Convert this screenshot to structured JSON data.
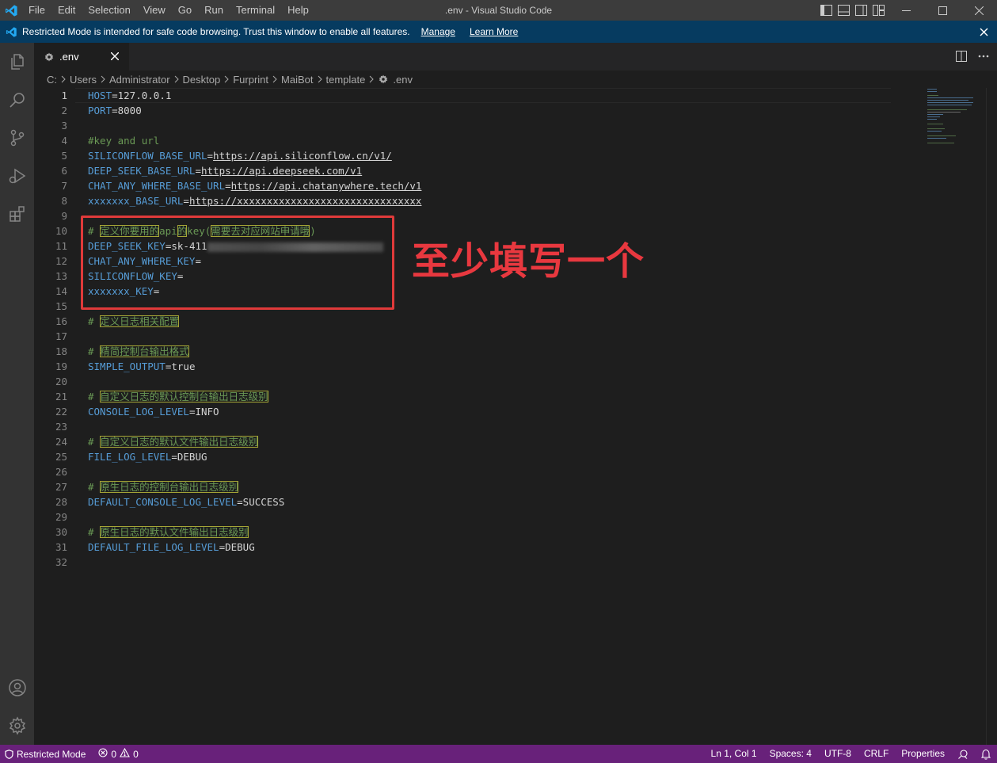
{
  "titlebar": {
    "menu": [
      "File",
      "Edit",
      "Selection",
      "View",
      "Go",
      "Run",
      "Terminal",
      "Help"
    ],
    "title": ".env - Visual Studio Code"
  },
  "banner": {
    "message": "Restricted Mode is intended for safe code browsing. Trust this window to enable all features.",
    "manage": "Manage",
    "learn_more": "Learn More"
  },
  "tab": {
    "label": ".env"
  },
  "breadcrumb": [
    "C:",
    "Users",
    "Administrator",
    "Desktop",
    "Furprint",
    "MaiBot",
    "template",
    ".env"
  ],
  "editor": {
    "line_numbers": [
      "1",
      "2",
      "3",
      "4",
      "5",
      "6",
      "7",
      "8",
      "9",
      "10",
      "11",
      "12",
      "13",
      "14",
      "15",
      "16",
      "17",
      "18",
      "19",
      "20",
      "21",
      "22",
      "23",
      "24",
      "25",
      "26",
      "27",
      "28",
      "29",
      "30",
      "31",
      "32"
    ],
    "lines": {
      "l1k": "HOST",
      "l1v": "=127.0.0.1",
      "l2k": "PORT",
      "l2v": "=8000",
      "l4": "#key and url",
      "l5k": "SILICONFLOW_BASE_URL",
      "l5e": "=",
      "l5v": "https://api.siliconflow.cn/v1/",
      "l6k": "DEEP_SEEK_BASE_URL",
      "l6e": "=",
      "l6v": "https://api.deepseek.com/v1",
      "l7k": "CHAT_ANY_WHERE_BASE_URL",
      "l7e": "=",
      "l7v": "https://api.chatanywhere.tech/v1",
      "l8k": "xxxxxxx_BASE_URL",
      "l8e": "=",
      "l8v": "https://xxxxxxxxxxxxxxxxxxxxxxxxxxxxxxx",
      "l10a": "# ",
      "l10b": "定义你要用的",
      "l10c": "api",
      "l10d": "的",
      "l10e": "key(",
      "l10f": "需要去对应网站申请哦",
      "l10g": ")",
      "l11k": "DEEP_SEEK_KEY",
      "l11v": "=sk-411",
      "l12k": "CHAT_ANY_WHERE_KEY",
      "l12v": "=",
      "l13k": "SILICONFLOW_KEY",
      "l13v": "=",
      "l14k": "xxxxxxx_KEY",
      "l14v": "=",
      "l16a": "# ",
      "l16b": "定义日志相关配置",
      "l18a": "# ",
      "l18b": "精简控制台输出格式",
      "l19k": "SIMPLE_OUTPUT",
      "l19v": "=true",
      "l21a": "# ",
      "l21b": "自定义日志的默认控制台输出日志级别",
      "l22k": "CONSOLE_LOG_LEVEL",
      "l22v": "=INFO",
      "l24a": "# ",
      "l24b": "自定义日志的默认文件输出日志级别",
      "l25k": "FILE_LOG_LEVEL",
      "l25v": "=DEBUG",
      "l27a": "# ",
      "l27b": "原生日志的控制台输出日志级别",
      "l28k": "DEFAULT_CONSOLE_LOG_LEVEL",
      "l28v": "=SUCCESS",
      "l30a": "# ",
      "l30b": "原生日志的默认文件输出日志级别",
      "l31k": "DEFAULT_FILE_LOG_LEVEL",
      "l31v": "=DEBUG"
    },
    "annotation": "至少填写一个"
  },
  "statusbar": {
    "restricted": "Restricted Mode",
    "errors": "0",
    "warnings": "0",
    "position": "Ln 1, Col 1",
    "spaces": "Spaces: 4",
    "encoding": "UTF-8",
    "eol": "CRLF",
    "language": "Properties"
  },
  "colors": {
    "keyword": "#569cd6",
    "comment": "#6a9955",
    "annotation": "#e8383f",
    "statusbar": "#68217a",
    "banner": "#063b60"
  }
}
